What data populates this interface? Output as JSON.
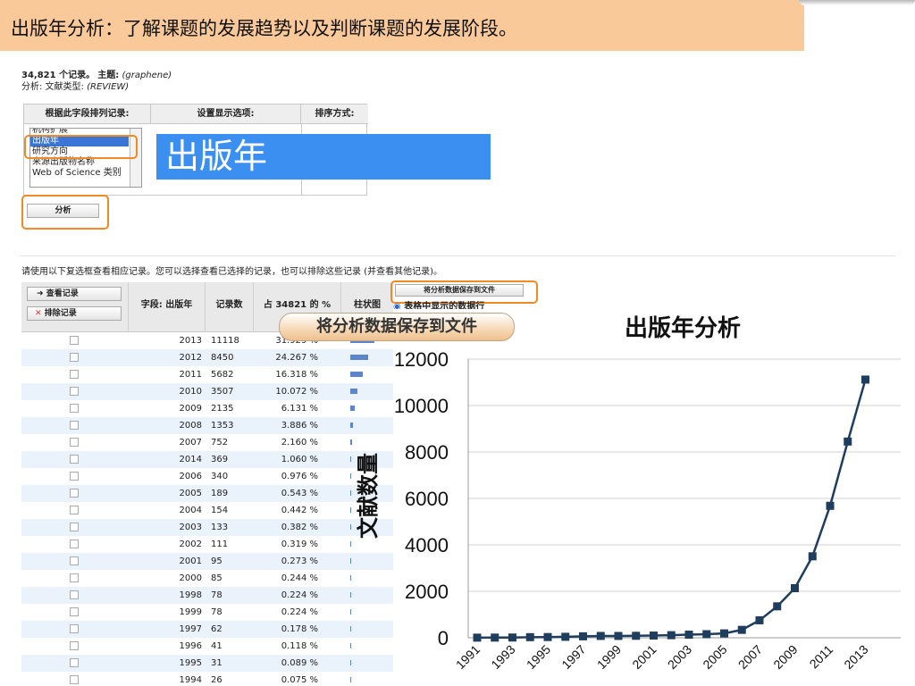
{
  "slide_title": "出版年分析：了解课题的发展趋势以及判断课题的发展阶段。",
  "summary": {
    "count_text": "34,821 个记录。",
    "topic_label": "主题:",
    "topic_value": "(graphene)",
    "refine_label": "分析: 文献类型:",
    "refine_value": "(REVIEW)"
  },
  "config": {
    "headers": [
      "根据此字段排列记录:",
      "设置显示选项:",
      "排序方式:"
    ],
    "field_options": [
      "机构扩展",
      "出版年",
      "研究方向",
      "来源出版物名称",
      "Web of Science 类别"
    ],
    "selected_index": 1,
    "analyze_button": "分析"
  },
  "big_label": "出版年",
  "hint_text": "请使用以下复选框查看相应记录。您可以选择查看已选择的记录，也可以排除这些记录 (并查看其他记录)。",
  "table": {
    "view_button": "查看记录",
    "exclude_button": "排除记录",
    "col_field": "字段: 出版年",
    "col_count": "记录数",
    "col_pct_prefix": "占",
    "col_pct_total": "34821",
    "col_pct_suffix": "的 %",
    "col_bar": "柱状图",
    "save_button": "将分析数据保存到文件",
    "radio_text": "表格中显示的数据行",
    "rows": [
      {
        "year": "2013",
        "count": "11118",
        "pct": "31.929 %",
        "frac": 0.31929
      },
      {
        "year": "2012",
        "count": "8450",
        "pct": "24.267 %",
        "frac": 0.24267
      },
      {
        "year": "2011",
        "count": "5682",
        "pct": "16.318 %",
        "frac": 0.16318
      },
      {
        "year": "2010",
        "count": "3507",
        "pct": "10.072 %",
        "frac": 0.10072
      },
      {
        "year": "2009",
        "count": "2135",
        "pct": "6.131 %",
        "frac": 0.06131
      },
      {
        "year": "2008",
        "count": "1353",
        "pct": "3.886 %",
        "frac": 0.03886
      },
      {
        "year": "2007",
        "count": "752",
        "pct": "2.160 %",
        "frac": 0.0216
      },
      {
        "year": "2014",
        "count": "369",
        "pct": "1.060 %",
        "frac": 0.0106
      },
      {
        "year": "2006",
        "count": "340",
        "pct": "0.976 %",
        "frac": 0.00976
      },
      {
        "year": "2005",
        "count": "189",
        "pct": "0.543 %",
        "frac": 0.00543
      },
      {
        "year": "2004",
        "count": "154",
        "pct": "0.442 %",
        "frac": 0.00442
      },
      {
        "year": "2003",
        "count": "133",
        "pct": "0.382 %",
        "frac": 0.00382
      },
      {
        "year": "2002",
        "count": "111",
        "pct": "0.319 %",
        "frac": 0.00319
      },
      {
        "year": "2001",
        "count": "95",
        "pct": "0.273 %",
        "frac": 0.00273
      },
      {
        "year": "2000",
        "count": "85",
        "pct": "0.244 %",
        "frac": 0.00244
      },
      {
        "year": "1998",
        "count": "78",
        "pct": "0.224 %",
        "frac": 0.00224
      },
      {
        "year": "1999",
        "count": "78",
        "pct": "0.224 %",
        "frac": 0.00224
      },
      {
        "year": "1997",
        "count": "62",
        "pct": "0.178 %",
        "frac": 0.00178
      },
      {
        "year": "1996",
        "count": "41",
        "pct": "0.118 %",
        "frac": 0.00118
      },
      {
        "year": "1995",
        "count": "31",
        "pct": "0.089 %",
        "frac": 0.00089
      },
      {
        "year": "1994",
        "count": "26",
        "pct": "0.075 %",
        "frac": 0.00075
      }
    ]
  },
  "save_callout": "将分析数据保存到文件",
  "chart_data": {
    "type": "line",
    "title": "出版年分析",
    "xlabel": "",
    "ylabel": "文献数量",
    "ylim": [
      0,
      12000
    ],
    "yticks": [
      0,
      2000,
      4000,
      6000,
      8000,
      10000,
      12000
    ],
    "xtick_labels": [
      "1991",
      "1993",
      "1995",
      "1997",
      "1999",
      "2001",
      "2003",
      "2005",
      "2007",
      "2009",
      "2011",
      "2013"
    ],
    "x": [
      1991,
      1992,
      1993,
      1994,
      1995,
      1996,
      1997,
      1998,
      1999,
      2000,
      2001,
      2002,
      2003,
      2004,
      2005,
      2006,
      2007,
      2008,
      2009,
      2010,
      2011,
      2012,
      2013
    ],
    "values": [
      5,
      8,
      10,
      26,
      31,
      41,
      62,
      78,
      78,
      85,
      95,
      111,
      133,
      154,
      189,
      340,
      752,
      1353,
      2135,
      3507,
      5682,
      8450,
      11118
    ],
    "grid": true,
    "colors": {
      "line": "#1f3d5c",
      "marker": "#1f3d5c",
      "grid": "#d0d0d0"
    }
  }
}
